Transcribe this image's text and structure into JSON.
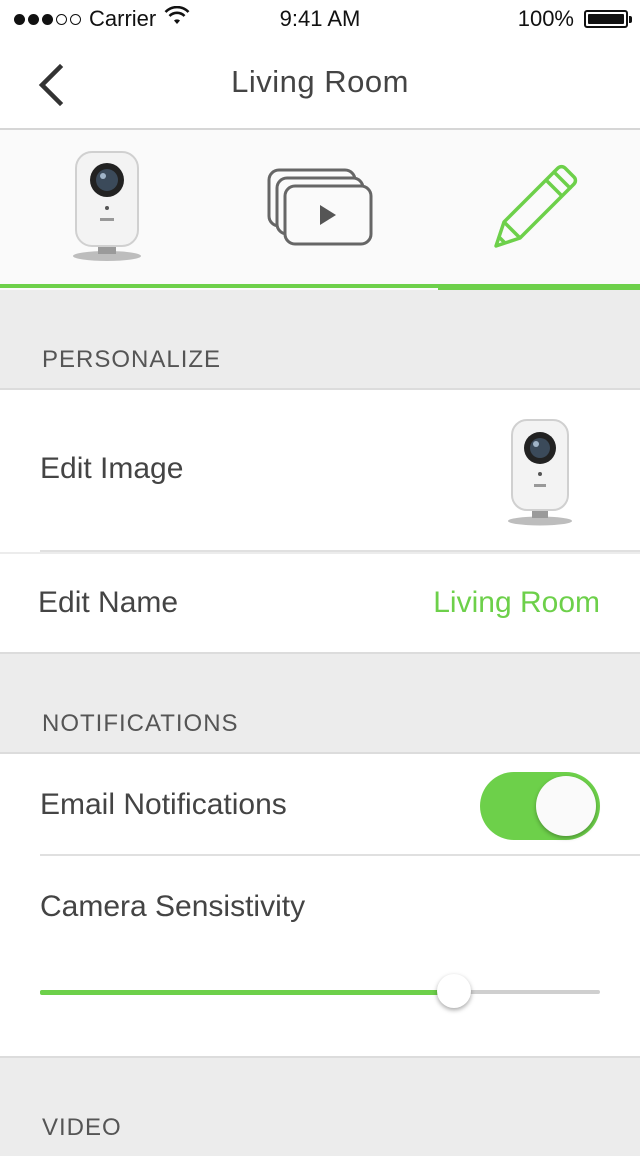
{
  "status_bar": {
    "carrier": "Carrier",
    "time": "9:41 AM",
    "battery": "100%",
    "signal_bars_filled": 3,
    "signal_bars_total": 5
  },
  "nav": {
    "title": "Living Room",
    "back_icon": "chevron-left-icon"
  },
  "tabs": [
    {
      "id": "camera",
      "icon": "camera-icon",
      "active": false
    },
    {
      "id": "videos",
      "icon": "video-clips-icon",
      "active": false
    },
    {
      "id": "edit",
      "icon": "pencil-icon",
      "active": true
    }
  ],
  "sections": {
    "personalize": {
      "label": "PERSONALIZE",
      "edit_image_label": "Edit Image",
      "edit_name_label": "Edit Name",
      "edit_name_value": "Living Room"
    },
    "notifications": {
      "label": "NOTIFICATIONS",
      "email_label": "Email Notifications",
      "email_enabled": true,
      "sensitivity_label": "Camera Sensistivity",
      "sensitivity_level": 0.74
    },
    "video": {
      "label": "VIDEO"
    }
  },
  "colors": {
    "accent": "#6dd04a",
    "background": "#ececec",
    "text": "#444444"
  }
}
